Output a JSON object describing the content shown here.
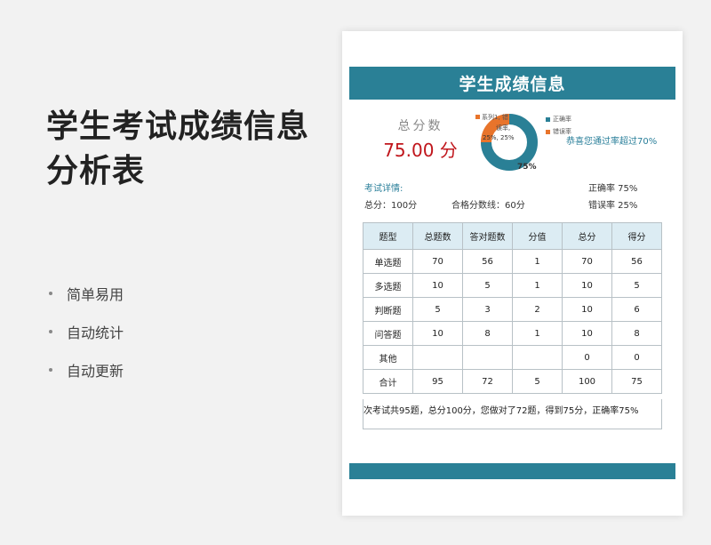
{
  "promo": {
    "title": "学生考试成绩信息分析表",
    "features": [
      "简单易用",
      "自动统计",
      "自动更新"
    ]
  },
  "sheet": {
    "banner_title": "学生成绩信息",
    "score_label": "总分数",
    "score_value": "75.00 分",
    "chart": {
      "series_label": "系列1, 错",
      "wrong_label": "误率,",
      "wrong_pct_label": "25%, 25%",
      "correct_pct_label": "75%",
      "legend_correct": "正确率",
      "legend_wrong": "错误率"
    },
    "congrats": "恭喜您通过率超过70%",
    "detail_title": "考试详情:",
    "total_points": "总分：100分",
    "pass_line": "合格分数线：60分",
    "correct_rate": "正确率 75%",
    "wrong_rate": "错误率 25%",
    "table": {
      "headers": [
        "题型",
        "总题数",
        "答对题数",
        "分值",
        "总分",
        "得分"
      ],
      "rows": [
        [
          "单选题",
          "70",
          "56",
          "1",
          "70",
          "56"
        ],
        [
          "多选题",
          "10",
          "5",
          "1",
          "10",
          "5"
        ],
        [
          "判断题",
          "5",
          "3",
          "2",
          "10",
          "6"
        ],
        [
          "问答题",
          "10",
          "8",
          "1",
          "10",
          "8"
        ],
        [
          "其他",
          "",
          "",
          "",
          "0",
          "0"
        ],
        [
          "合计",
          "95",
          "72",
          "5",
          "100",
          "75"
        ]
      ]
    },
    "summary": "次考试共95题，总分100分，您做对了72题，得到75分，正确率75%"
  },
  "colors": {
    "accent": "#2a8096",
    "score_red": "#c0161c",
    "wrong_orange": "#e8742b"
  },
  "chart_data": {
    "type": "pie",
    "categories": [
      "正确率",
      "错误率"
    ],
    "values": [
      75,
      25
    ],
    "title": "",
    "legend": "right"
  }
}
